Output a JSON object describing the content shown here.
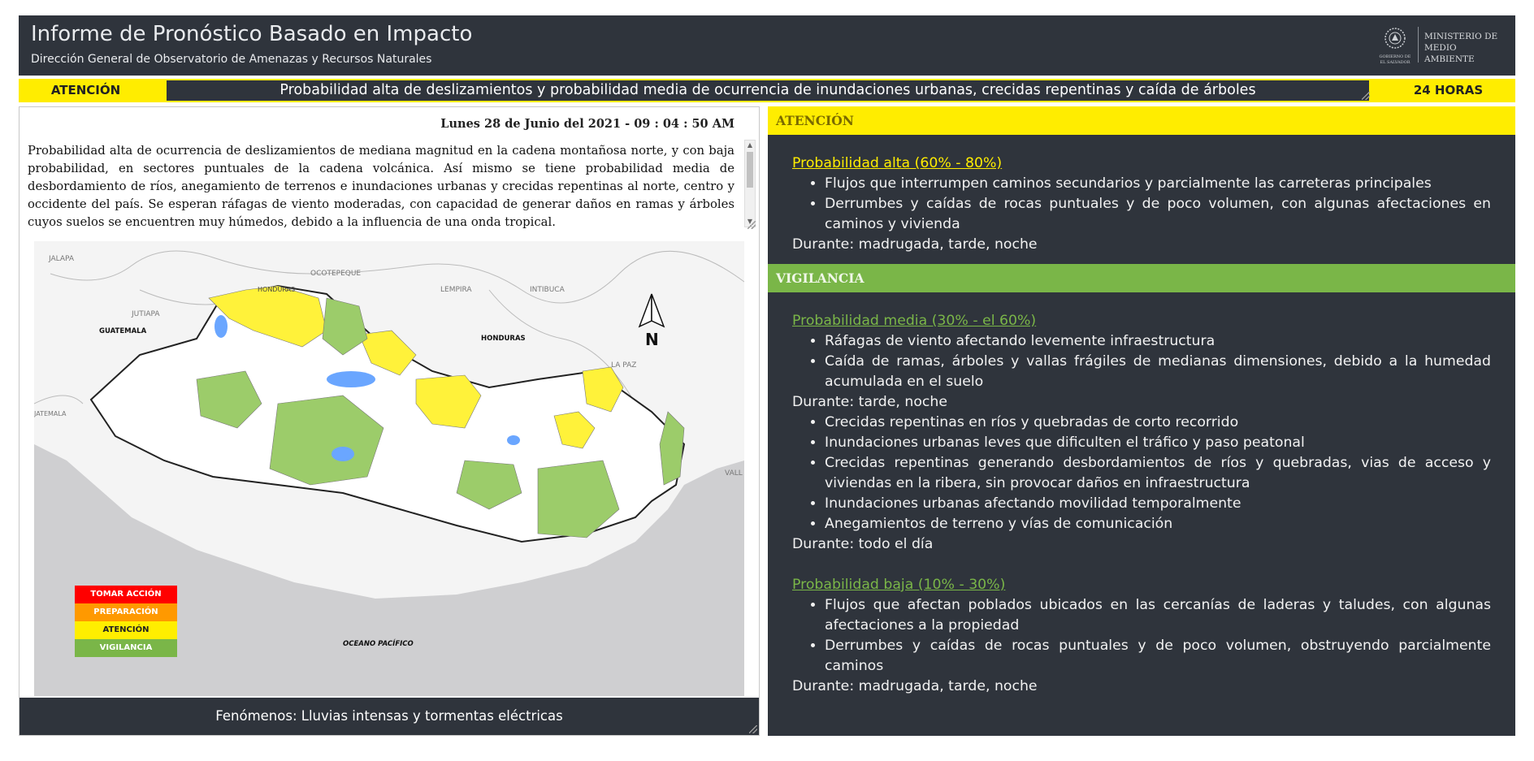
{
  "header": {
    "title": "Informe de Pronóstico Basado en Impacto",
    "subtitle": "Dirección General de Observatorio de Amenazas y Recursos Naturales",
    "ministry_line1": "MINISTERIO DE",
    "ministry_line2": "MEDIO AMBIENTE",
    "seal_text_line1": "GOBIERNO DE",
    "seal_text_line2": "EL SALVADOR"
  },
  "banner": {
    "level": "ATENCIÓN",
    "message": "Probabilidad alta de deslizamientos y probabilidad media de ocurrencia de inundaciones urbanas, crecidas repentinas y caída de árboles",
    "period": "24 HORAS"
  },
  "left": {
    "date": "Lunes 28 de Junio del 2021 - 09 : 04 : 50 AM",
    "description": " Probabilidad alta de ocurrencia de deslizamientos de mediana magnitud en la cadena montañosa norte, y con baja probabilidad, en sectores puntuales de la cadena volcánica. Así mismo se tiene probabilidad media de desbordamiento de ríos, anegamiento de terrenos e inundaciones urbanas y crecidas repentinas al norte, centro y occidente del país. Se esperan ráfagas de viento moderadas, con capacidad de generar daños en ramas y árboles cuyos suelos se encuentren muy húmedos, debido a la influencia de una onda tropical.",
    "map": {
      "labels": {
        "jalapa": "JALAPA",
        "ocotepeque": "OCOTEPEQUE",
        "lempira": "LEMPIRA",
        "intibuca": "INTIBUCA",
        "jutiapa": "JUTIAPA",
        "guatemala": "GUATEMALA",
        "honduras": "HONDURAS",
        "honduras_border": "HONDURAS",
        "la_paz": "LA PAZ",
        "valle": "VALL",
        "jutiapa2": "JATEMALA",
        "oceano": "OCEANO PACÍFICO",
        "north": "N"
      },
      "legend": [
        {
          "label": "TOMAR ACCIÓN",
          "color": "#ff0000"
        },
        {
          "label": "PREPARACIÓN",
          "color": "#ff9900"
        },
        {
          "label": "ATENCIÓN",
          "color": "#ffee00"
        },
        {
          "label": "VIGILANCIA",
          "color": "#7ab648"
        }
      ]
    },
    "footer": "Fenómenos: Lluvias intensas y tormentas eléctricas"
  },
  "right": {
    "atencion": {
      "label": "ATENCIÓN",
      "color": "#ffed00",
      "prob": "Probabilidad alta (60% - 80%)",
      "prob_color": "#ffed00",
      "items": [
        "Flujos que interrumpen caminos secundarios y parcialmente las carreteras principales",
        "Derrumbes y caídas de rocas puntuales y de poco volumen, con algunas afectaciones en caminos y vivienda"
      ],
      "durante": "Durante: madrugada, tarde, noche"
    },
    "vigilancia": {
      "label": "VIGILANCIA",
      "color": "#7ab648",
      "prob_media": "Probabilidad media (30% - el 60%)",
      "media_items_a": [
        "Ráfagas de viento afectando levemente infraestructura",
        "Caída de ramas, árboles y vallas frágiles de medianas dimensiones, debido a la humedad acumulada en el suelo"
      ],
      "durante_a": "Durante: tarde, noche",
      "media_items_b": [
        "Crecidas repentinas en ríos y quebradas de corto recorrido",
        "Inundaciones urbanas leves que dificulten el tráfico y paso peatonal",
        "Crecidas repentinas generando desbordamientos de ríos y quebradas, vias de acceso y viviendas en la ribera, sin provocar daños en infraestructura",
        "Inundaciones urbanas afectando movilidad temporalmente",
        "Anegamientos de terreno y vías de comunicación"
      ],
      "durante_b": "Durante: todo el día",
      "prob_baja": "Probabilidad baja (10% - 30%)",
      "baja_items": [
        "Flujos que afectan poblados ubicados en las cercanías de laderas y taludes, con algunas afectaciones a la propiedad",
        "Derrumbes y caídas de rocas puntuales y de poco volumen, obstruyendo parcialmente caminos"
      ],
      "durante_c": "Durante: madrugada, tarde, noche"
    }
  }
}
